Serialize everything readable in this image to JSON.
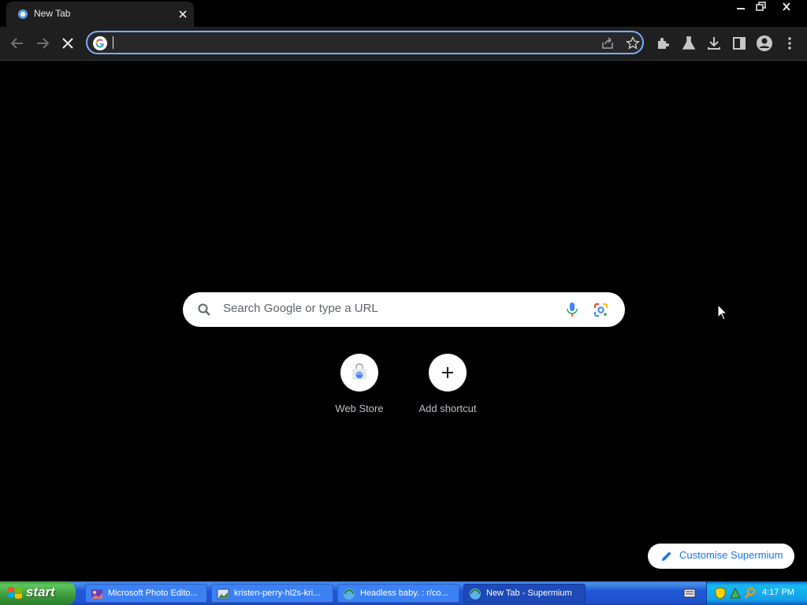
{
  "tab": {
    "title": "New Tab"
  },
  "omnibox": {
    "value": "",
    "placeholder": ""
  },
  "ntp": {
    "search_placeholder": "Search Google or type a URL",
    "shortcuts": [
      {
        "label": "Web Store",
        "icon": "webstore-icon"
      },
      {
        "label": "Add shortcut",
        "icon": "plus-icon"
      }
    ],
    "customise_label": "Customise Supermium"
  },
  "taskbar": {
    "start_label": "start",
    "tasks": [
      {
        "label": "Microsoft Photo Edito...",
        "icon": "photo-editor-icon"
      },
      {
        "label": "kristen-perry-hl2s-kri...",
        "icon": "image-file-icon"
      },
      {
        "label": "Headless baby. : r/co...",
        "icon": "browser-icon"
      },
      {
        "label": "New Tab - Supermium",
        "icon": "browser-icon",
        "active": true
      }
    ],
    "clock": "4:17 PM"
  },
  "colors": {
    "accent": "#7cacf8",
    "link_blue": "#1a73e8",
    "toolbar_bg": "#1f1f1f",
    "taskbar_blue": "#2157d7",
    "start_green": "#3a9a3a"
  }
}
